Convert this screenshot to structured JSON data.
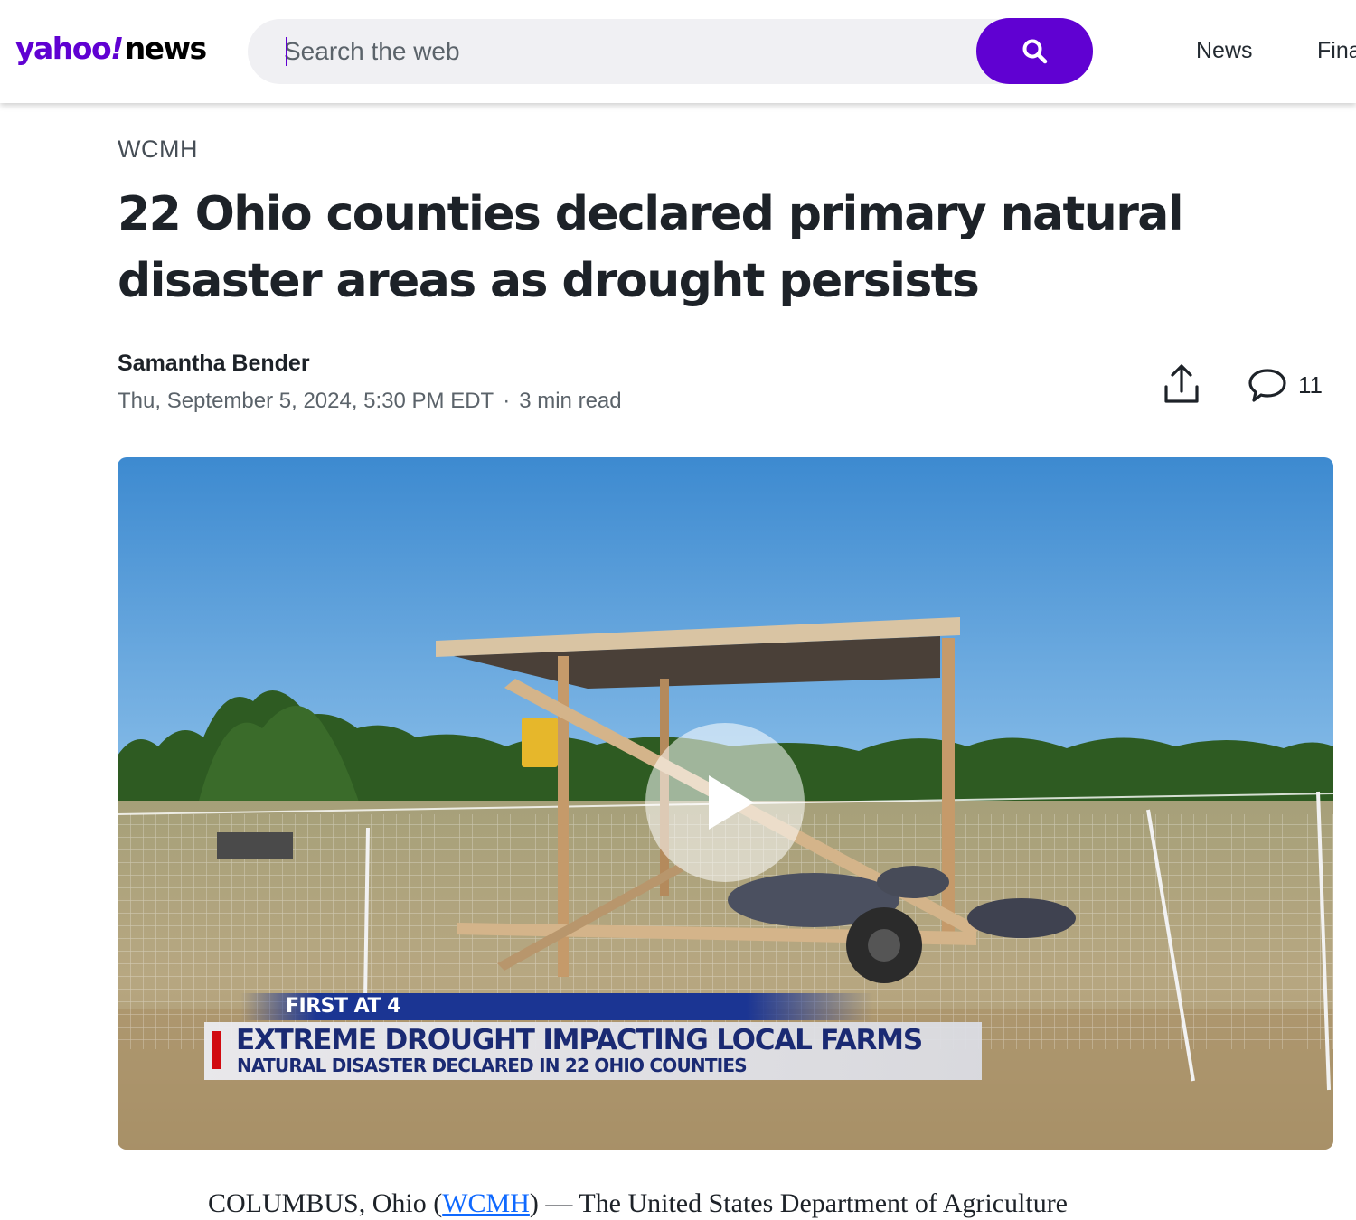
{
  "header": {
    "logo": {
      "brand": "yahoo",
      "bang": "!",
      "section": "news"
    },
    "search": {
      "placeholder": "Search the web",
      "button_icon": "search-icon"
    },
    "nav": [
      "News",
      "Fina"
    ]
  },
  "article": {
    "provider": "WCMH",
    "headline": "22 Ohio counties declared primary natural disaster areas as drought persists",
    "author": "Samantha Bender",
    "date": "Thu, September 5, 2024, 5:30 PM EDT",
    "separator": "·",
    "read_time": "3 min read",
    "comment_count": "11",
    "icons": {
      "share": "share-icon",
      "comments": "comment-bubble-icon"
    }
  },
  "video": {
    "play_icon": "play-icon",
    "lower_third": {
      "tag": "FIRST AT 4",
      "headline": "EXTREME DROUGHT IMPACTING LOCAL FARMS",
      "subheadline": "NATURAL DISASTER DECLARED IN 22 OHIO COUNTIES"
    }
  },
  "body": {
    "prefix": "COLUMBUS, Ohio (",
    "link": "WCMH",
    "suffix": ") — The United States Department of Agriculture"
  },
  "colors": {
    "brand_purple": "#6001d2",
    "text_primary": "#1d2228",
    "text_secondary": "#5b636a",
    "link_blue": "#0f69ff",
    "sky": "#4b96d6",
    "news_red": "#d10a10",
    "news_blue": "#1b3593"
  }
}
